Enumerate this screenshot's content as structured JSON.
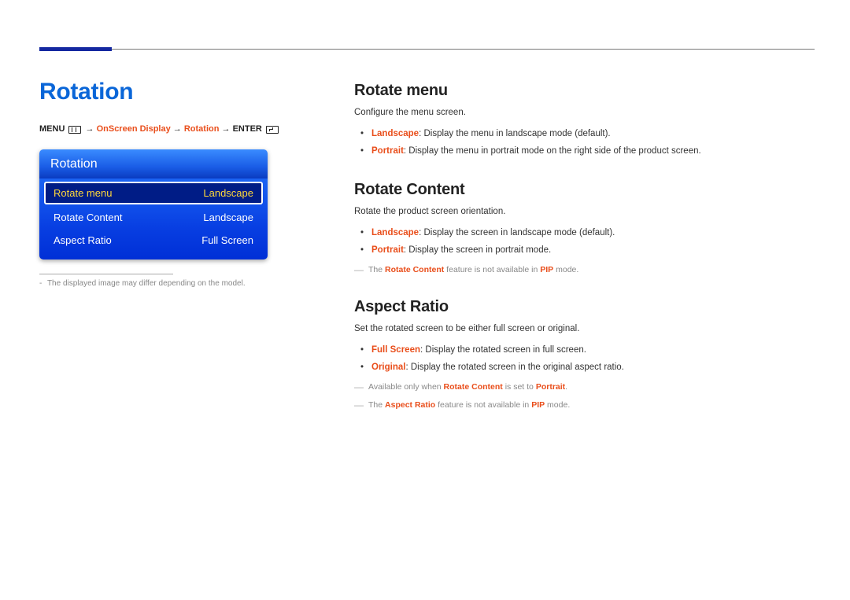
{
  "header": {
    "page_title": "Rotation"
  },
  "breadcrumb": {
    "menu": "MENU",
    "arrow": " → ",
    "step1": "OnScreen Display",
    "step2": "Rotation",
    "enter": "ENTER"
  },
  "osd": {
    "title": "Rotation",
    "rows": [
      {
        "label": "Rotate menu",
        "value": "Landscape",
        "selected": true
      },
      {
        "label": "Rotate Content",
        "value": "Landscape",
        "selected": false
      },
      {
        "label": "Aspect Ratio",
        "value": "Full Screen",
        "selected": false
      }
    ],
    "caption_dash": "-",
    "caption": "The displayed image may differ depending on the model."
  },
  "sections": {
    "rotate_menu": {
      "title": "Rotate menu",
      "intro": "Configure the menu screen.",
      "items": [
        {
          "kw": "Landscape",
          "text": ": Display the menu in landscape mode (default)."
        },
        {
          "kw": "Portrait",
          "text": ": Display the menu in portrait mode on the right side of the product screen."
        }
      ]
    },
    "rotate_content": {
      "title": "Rotate Content",
      "intro": "Rotate the product screen orientation.",
      "items": [
        {
          "kw": "Landscape",
          "text": ": Display the screen in landscape mode (default)."
        },
        {
          "kw": "Portrait",
          "text": ": Display the screen in portrait mode."
        }
      ],
      "note_pre": "The ",
      "note_kw1": "Rotate Content",
      "note_mid": " feature is not available in ",
      "note_kw2": "PIP",
      "note_post": " mode."
    },
    "aspect_ratio": {
      "title": "Aspect Ratio",
      "intro": "Set the rotated screen to be either full screen or original.",
      "items": [
        {
          "kw": "Full Screen",
          "text": ": Display the rotated screen in full screen."
        },
        {
          "kw": "Original",
          "text": ": Display the rotated screen in the original aspect ratio."
        }
      ],
      "note1_pre": "Available only when ",
      "note1_kw1": "Rotate Content",
      "note1_mid": " is set to ",
      "note1_kw2": "Portrait",
      "note1_post": ".",
      "note2_pre": "The ",
      "note2_kw1": "Aspect Ratio",
      "note2_mid": " feature is not available in ",
      "note2_kw2": "PIP",
      "note2_post": " mode."
    }
  }
}
